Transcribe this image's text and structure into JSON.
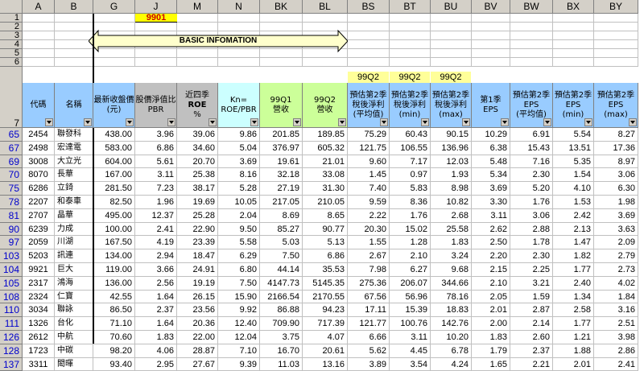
{
  "columns": [
    "A",
    "B",
    "G",
    "J",
    "M",
    "N",
    "BK",
    "BL",
    "BS",
    "BT",
    "BU",
    "BV",
    "BW",
    "BX",
    "BY"
  ],
  "top_rows": [
    "1",
    "2",
    "3",
    "4",
    "5",
    "6",
    "7"
  ],
  "highlight": {
    "code": "9901",
    "banner": "BASIC INFOMATION"
  },
  "quarter_labels": [
    "99Q2",
    "99Q2",
    "99Q2"
  ],
  "headers": [
    {
      "lines": [
        "代碼"
      ],
      "bg": "#99ccff"
    },
    {
      "lines": [
        "名稱"
      ],
      "bg": "#99ccff"
    },
    {
      "lines": [
        "最新收盤價",
        "(元)"
      ],
      "bg": "#99ccff"
    },
    {
      "lines": [
        "股價淨值比",
        "PBR"
      ],
      "bg": "#c0c0c0"
    },
    {
      "lines": [
        "近四季",
        "ROE",
        "%"
      ],
      "bg": "#c0c0c0"
    },
    {
      "lines": [
        "Kn=",
        "ROE/PBR"
      ],
      "bg": "#ccffff"
    },
    {
      "lines": [
        "99Q1",
        "營收"
      ],
      "bg": "#ccff99"
    },
    {
      "lines": [
        "99Q2",
        "營收"
      ],
      "bg": "#ccff99"
    },
    {
      "lines": [
        "預估第2季",
        "稅後淨利",
        "(平均值)"
      ],
      "bg": "#99ccff"
    },
    {
      "lines": [
        "預估第2季",
        "稅後淨利",
        "(min)"
      ],
      "bg": "#99ccff"
    },
    {
      "lines": [
        "預估第2季",
        "稅後淨利",
        "(max)"
      ],
      "bg": "#99ccff"
    },
    {
      "lines": [
        "第1季",
        "EPS"
      ],
      "bg": "#99ccff"
    },
    {
      "lines": [
        "預估第2季",
        "EPS",
        "(平均值)"
      ],
      "bg": "#99ccff"
    },
    {
      "lines": [
        "預估第2季",
        "EPS",
        "(min)"
      ],
      "bg": "#99ccff"
    },
    {
      "lines": [
        "預估第2季",
        "EPS",
        "(max)"
      ],
      "bg": "#99ccff"
    }
  ],
  "rows": [
    {
      "r": "65",
      "c": [
        "2454",
        "聯發科",
        "438.00",
        "3.96",
        "39.06",
        "9.86",
        "201.85",
        "189.85",
        "75.29",
        "60.43",
        "90.15",
        "10.29",
        "6.91",
        "5.54",
        "8.27"
      ]
    },
    {
      "r": "67",
      "c": [
        "2498",
        "宏達電",
        "583.00",
        "6.86",
        "34.60",
        "5.04",
        "376.97",
        "605.32",
        "121.75",
        "106.55",
        "136.96",
        "6.38",
        "15.43",
        "13.51",
        "17.36"
      ]
    },
    {
      "r": "69",
      "c": [
        "3008",
        "大立光",
        "604.00",
        "5.61",
        "20.70",
        "3.69",
        "19.61",
        "21.01",
        "9.60",
        "7.17",
        "12.03",
        "5.48",
        "7.16",
        "5.35",
        "8.97"
      ]
    },
    {
      "r": "70",
      "c": [
        "8070",
        "長華",
        "167.00",
        "3.11",
        "25.38",
        "8.16",
        "32.18",
        "33.08",
        "1.45",
        "0.97",
        "1.93",
        "5.34",
        "2.30",
        "1.54",
        "3.06"
      ]
    },
    {
      "r": "75",
      "c": [
        "6286",
        "立錡",
        "281.50",
        "7.23",
        "38.17",
        "5.28",
        "27.19",
        "31.30",
        "7.40",
        "5.83",
        "8.98",
        "3.69",
        "5.20",
        "4.10",
        "6.30"
      ]
    },
    {
      "r": "78",
      "c": [
        "2207",
        "和泰車",
        "82.50",
        "1.96",
        "19.69",
        "10.05",
        "217.05",
        "210.05",
        "9.59",
        "8.36",
        "10.82",
        "3.30",
        "1.76",
        "1.53",
        "1.98"
      ]
    },
    {
      "r": "81",
      "c": [
        "2707",
        "晶華",
        "495.00",
        "12.37",
        "25.28",
        "2.04",
        "8.69",
        "8.65",
        "2.22",
        "1.76",
        "2.68",
        "3.11",
        "3.06",
        "2.42",
        "3.69"
      ]
    },
    {
      "r": "90",
      "c": [
        "6239",
        "力成",
        "100.00",
        "2.41",
        "22.90",
        "9.50",
        "85.27",
        "90.77",
        "20.30",
        "15.02",
        "25.58",
        "2.62",
        "2.88",
        "2.13",
        "3.63"
      ]
    },
    {
      "r": "97",
      "c": [
        "2059",
        "川湖",
        "167.50",
        "4.19",
        "23.39",
        "5.58",
        "5.03",
        "5.13",
        "1.55",
        "1.28",
        "1.83",
        "2.50",
        "1.78",
        "1.47",
        "2.09"
      ]
    },
    {
      "r": "103",
      "c": [
        "5203",
        "訊連",
        "134.00",
        "2.94",
        "18.47",
        "6.29",
        "7.50",
        "6.86",
        "2.67",
        "2.10",
        "3.24",
        "2.20",
        "2.30",
        "1.82",
        "2.79"
      ]
    },
    {
      "r": "104",
      "c": [
        "9921",
        "巨大",
        "119.00",
        "3.66",
        "24.91",
        "6.80",
        "44.14",
        "35.53",
        "7.98",
        "6.27",
        "9.68",
        "2.15",
        "2.25",
        "1.77",
        "2.73"
      ]
    },
    {
      "r": "105",
      "c": [
        "2317",
        "鴻海",
        "136.00",
        "2.56",
        "19.19",
        "7.50",
        "4147.73",
        "5145.35",
        "275.36",
        "206.07",
        "344.66",
        "2.10",
        "3.21",
        "2.40",
        "4.02"
      ]
    },
    {
      "r": "108",
      "c": [
        "2324",
        "仁寶",
        "42.55",
        "1.64",
        "26.15",
        "15.90",
        "2166.54",
        "2170.55",
        "67.56",
        "56.96",
        "78.16",
        "2.05",
        "1.59",
        "1.34",
        "1.84"
      ]
    },
    {
      "r": "110",
      "c": [
        "3034",
        "聯詠",
        "86.50",
        "2.37",
        "23.56",
        "9.92",
        "86.88",
        "94.23",
        "17.11",
        "15.39",
        "18.83",
        "2.01",
        "2.87",
        "2.58",
        "3.16"
      ]
    },
    {
      "r": "111",
      "c": [
        "1326",
        "台化",
        "71.10",
        "1.64",
        "20.36",
        "12.40",
        "709.90",
        "717.39",
        "121.77",
        "100.76",
        "142.76",
        "2.00",
        "2.14",
        "1.77",
        "2.51"
      ]
    },
    {
      "r": "126",
      "c": [
        "2612",
        "中航",
        "70.60",
        "1.83",
        "22.00",
        "12.04",
        "3.75",
        "4.07",
        "6.66",
        "3.11",
        "10.20",
        "1.83",
        "2.60",
        "1.21",
        "3.98"
      ]
    },
    {
      "r": "128",
      "c": [
        "1723",
        "中碳",
        "98.20",
        "4.06",
        "28.87",
        "7.10",
        "16.70",
        "20.61",
        "5.62",
        "4.45",
        "6.78",
        "1.79",
        "2.37",
        "1.88",
        "2.86"
      ]
    },
    {
      "r": "137",
      "c": [
        "3311",
        "閎暉",
        "93.40",
        "2.95",
        "27.67",
        "9.39",
        "11.03",
        "13.16",
        "3.89",
        "3.54",
        "4.24",
        "1.65",
        "2.21",
        "2.01",
        "2.41"
      ]
    }
  ]
}
